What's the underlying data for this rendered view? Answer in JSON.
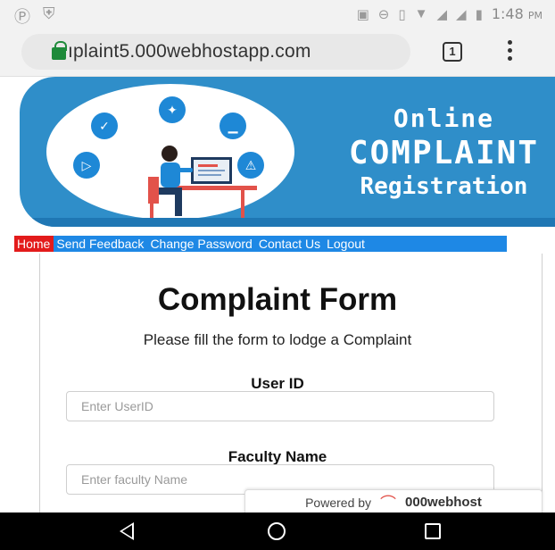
{
  "status_bar": {
    "time": "1:48",
    "ampm": "PM",
    "left_icons": [
      "parking-icon",
      "shield-icon"
    ],
    "right_icons": [
      "nfc-icon",
      "dnd-icon",
      "vibrate-icon",
      "wifi-icon",
      "signal-icon",
      "battery-icon"
    ]
  },
  "browser": {
    "url": "ıplaint5.000webhostapp.com",
    "tab_count": "1"
  },
  "banner": {
    "line1": "Online",
    "line2": "COMPLAINT",
    "line3": "Registration",
    "colors": {
      "background": "#2f8ec9",
      "icon": "#1e88d6"
    }
  },
  "nav": {
    "items": [
      "Home",
      "Send Feedback",
      "Change Password",
      "Contact Us",
      "Logout"
    ],
    "active": "Home",
    "colors": {
      "bar": "#1e88e5",
      "active": "#e31b1b"
    }
  },
  "form": {
    "title": "Complaint Form",
    "subtitle": "Please fill the form to lodge a Complaint",
    "fields": [
      {
        "label": "User ID",
        "placeholder": "Enter UserID"
      },
      {
        "label": "Faculty Name",
        "placeholder": "Enter faculty Name"
      }
    ]
  },
  "powered": {
    "text": "Powered by",
    "brand": "000webhost"
  }
}
